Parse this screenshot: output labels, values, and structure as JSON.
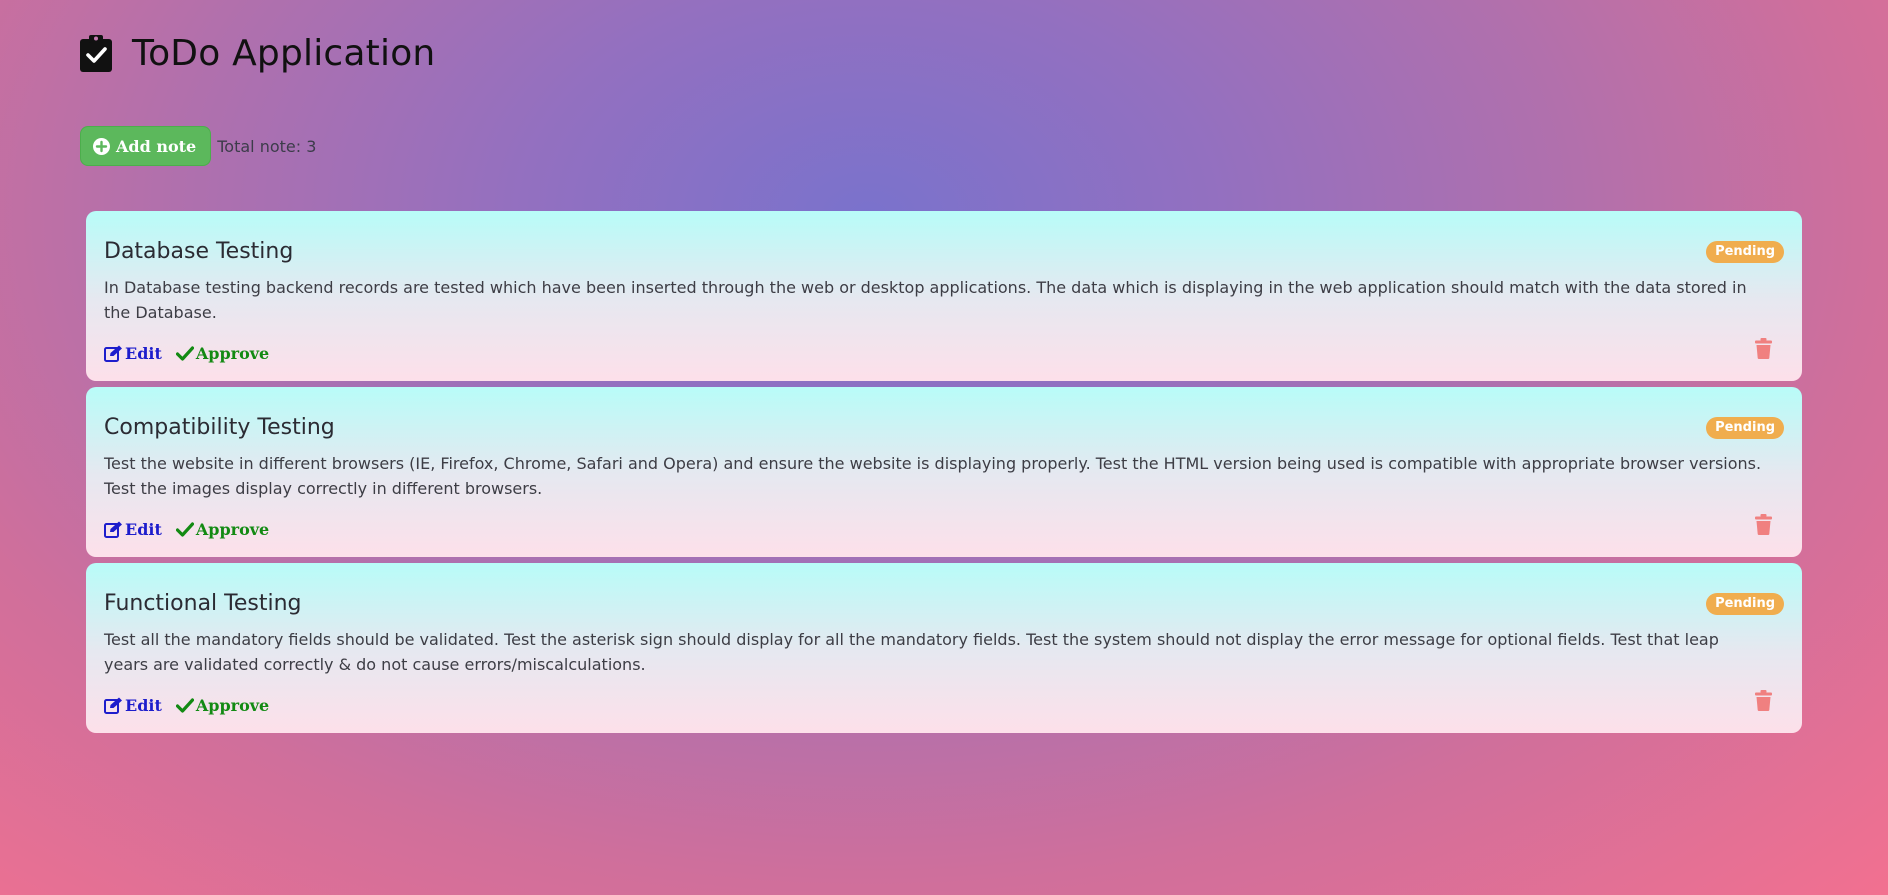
{
  "app": {
    "title": "ToDo Application"
  },
  "toolbar": {
    "add_label": "Add note",
    "total_label": "Total note: 3"
  },
  "notes": [
    {
      "title": "Database Testing",
      "description": "In Database testing backend records are tested which have been inserted through the web or desktop applications. The data which is displaying in the web application should match with the data stored in the Database.",
      "status": "Pending",
      "edit_label": "Edit",
      "approve_label": "Approve"
    },
    {
      "title": "Compatibility Testing",
      "description": "Test the website in different browsers (IE, Firefox, Chrome, Safari and Opera) and ensure the website is displaying properly. Test the HTML version being used is compatible with appropriate browser versions. Test the images display correctly in different browsers.",
      "status": "Pending",
      "edit_label": "Edit",
      "approve_label": "Approve"
    },
    {
      "title": "Functional Testing",
      "description": "Test all the mandatory fields should be validated. Test the asterisk sign should display for all the mandatory fields. Test the system should not display the error message for optional fields. Test that leap years are validated correctly & do not cause errors/miscalculations.",
      "status": "Pending",
      "edit_label": "Edit",
      "approve_label": "Approve"
    }
  ],
  "icons": {
    "logo": "clipboard-check-icon",
    "add": "plus-circle-icon",
    "edit": "edit-icon",
    "approve": "check-icon",
    "delete": "trash-icon"
  },
  "colors": {
    "add_button": "#5cb85c",
    "badge": "#f0ad4e",
    "edit": "#1d1dcc",
    "approve": "#138a13",
    "trash": "#f08080"
  }
}
